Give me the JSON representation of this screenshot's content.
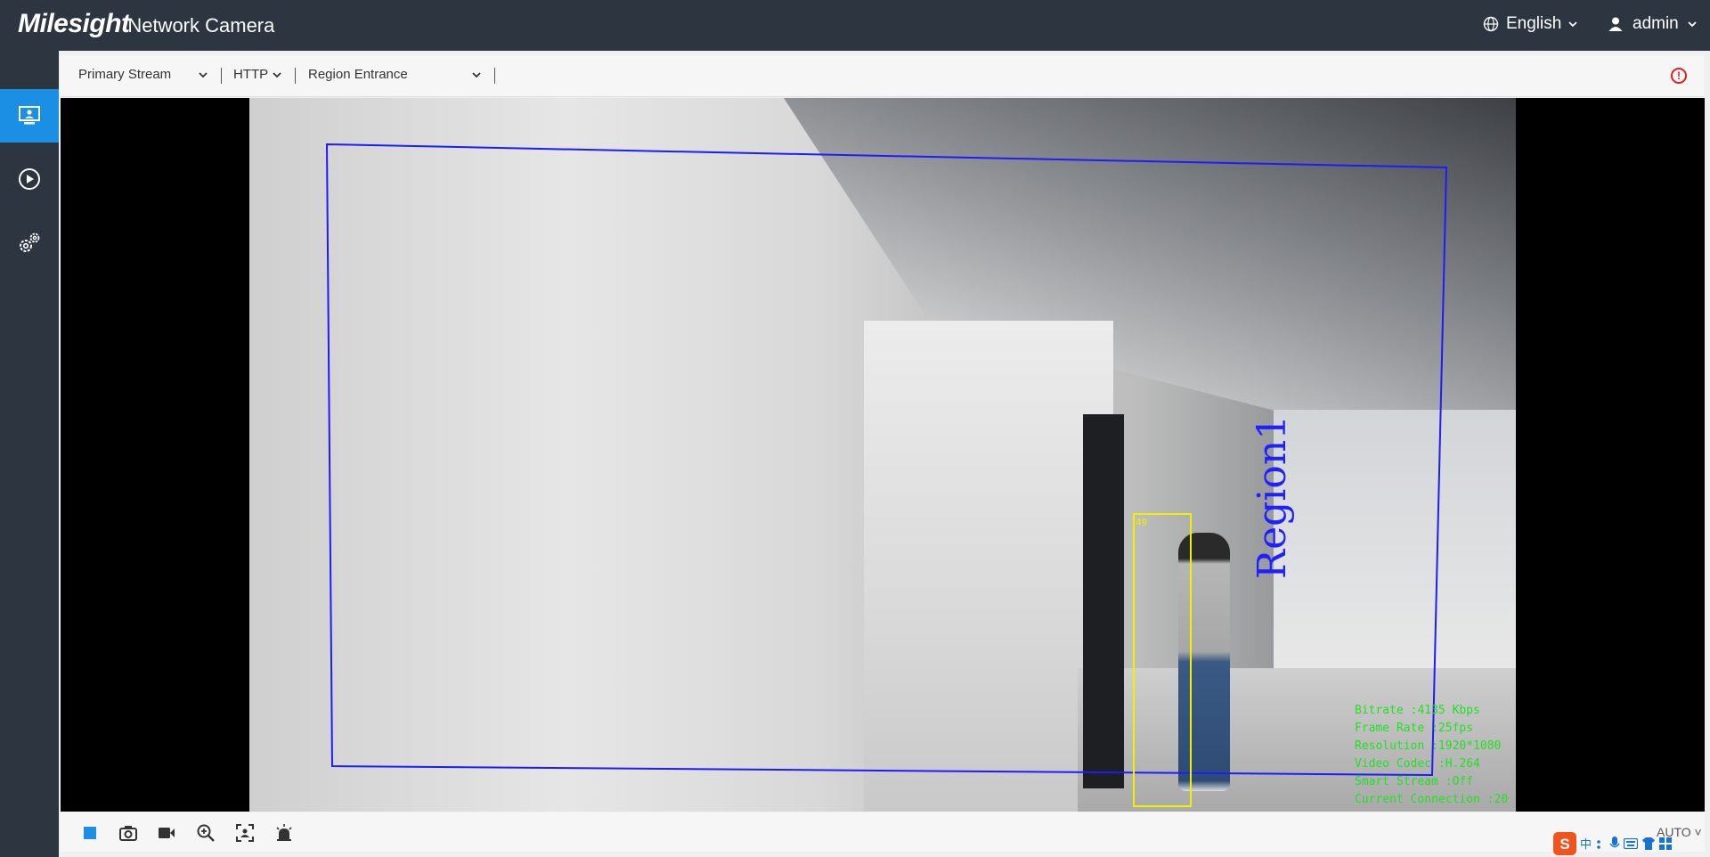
{
  "header": {
    "logo": "Milesight",
    "product": "·Network Camera",
    "language": "English",
    "user": "admin"
  },
  "sidebar": {
    "items": [
      {
        "name": "live-view",
        "icon": "monitor-icon",
        "active": true
      },
      {
        "name": "playback",
        "icon": "play-circle-icon",
        "active": false
      },
      {
        "name": "settings",
        "icon": "gear-icon",
        "active": false
      }
    ]
  },
  "toolbar": {
    "stream": "Primary Stream",
    "protocol": "HTTP",
    "mode": "Region Entrance",
    "alert_icon": "alert-circle-icon"
  },
  "overlay": {
    "region_label": "Region1",
    "target_id": "49",
    "osd_lines": [
      "Bitrate :4135 Kbps",
      "Frame Rate :25fps",
      "Resolution :1920*1080",
      "Video Codec :H.264",
      "Smart Stream :Off",
      "Current Connection :20"
    ],
    "colors": {
      "region": "#1c1cff",
      "target": "#f0f000",
      "osd": "#22e122"
    }
  },
  "bottombar": {
    "icons": [
      "stop-icon",
      "snapshot-icon",
      "record-icon",
      "zoom-icon",
      "fullscreen-crop-icon",
      "alarm-icon"
    ],
    "zoom_mode": "AUTO"
  },
  "ime": {
    "label": "中"
  }
}
